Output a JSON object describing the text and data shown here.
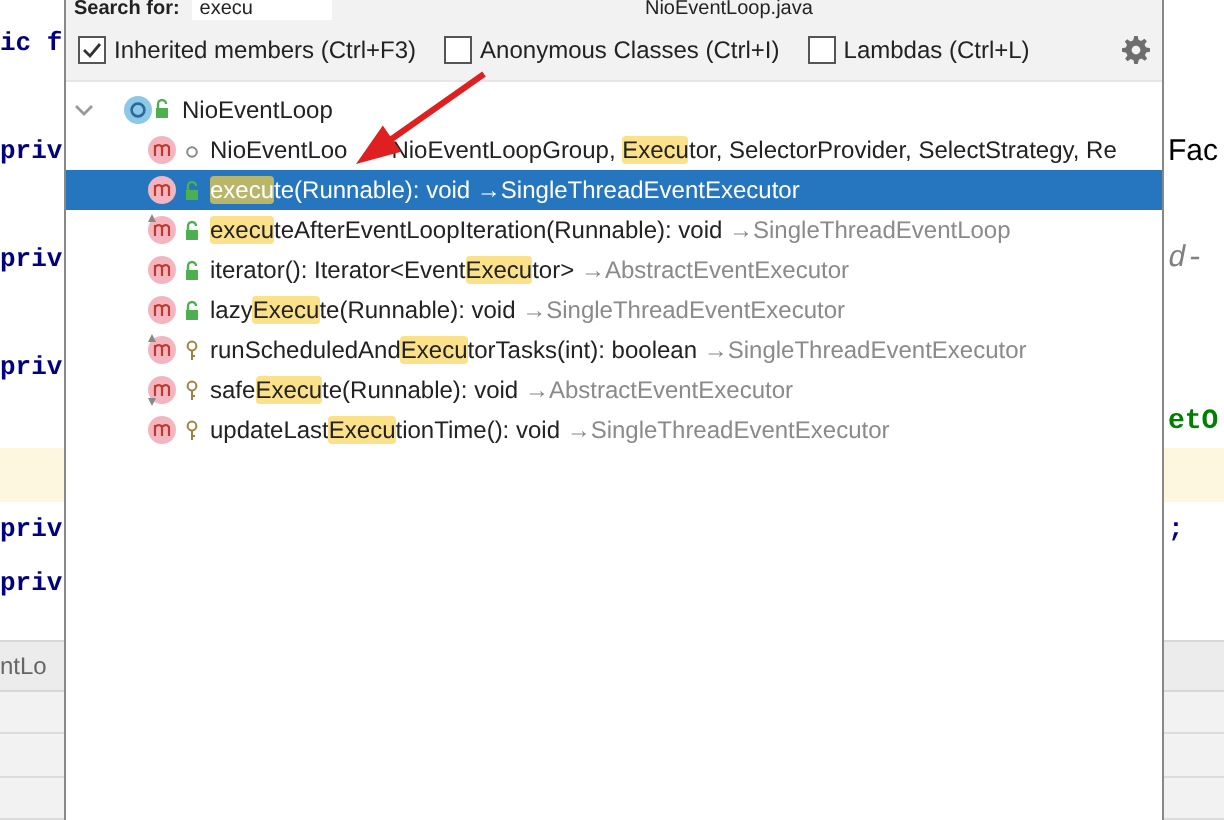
{
  "popup": {
    "search_label": "Search for:",
    "search_value": "execu",
    "file_title": "NioEventLoop.java",
    "options": [
      {
        "label": "Inherited members (Ctrl+F3)",
        "checked": true
      },
      {
        "label": "Anonymous Classes (Ctrl+I)",
        "checked": false
      },
      {
        "label": "Lambdas (Ctrl+L)",
        "checked": false
      }
    ],
    "tree": {
      "name": "NioEventLoop",
      "expanded": true,
      "children": [
        {
          "parts": [
            {
              "text": "NioEventLoo"
            },
            {
              "text": "NioEventLoopGroup, ",
              "after_arrow": true
            },
            {
              "text": "Execu",
              "match": true
            },
            {
              "text": "tor, SelectorProvider, SelectStrategy, Re"
            }
          ],
          "kind": "package",
          "overrides": false,
          "implements": false,
          "selected": false
        },
        {
          "parts": [
            {
              "text": "execu",
              "match": true
            },
            {
              "text": "te(Runnable): void "
            }
          ],
          "origin": "→SingleThreadEventExecutor",
          "kind": "public",
          "overrides": false,
          "implements": false,
          "selected": true
        },
        {
          "parts": [
            {
              "text": "execu",
              "match": true
            },
            {
              "text": "teAfterEventLoopIteration(Runnable): void "
            }
          ],
          "origin": "→SingleThreadEventLoop",
          "kind": "public",
          "overrides": true,
          "implements": false,
          "selected": false
        },
        {
          "parts": [
            {
              "text": "iterator(): Iterator<Event"
            },
            {
              "text": "Execu",
              "match": true
            },
            {
              "text": "tor> "
            }
          ],
          "origin": "→AbstractEventExecutor",
          "kind": "public",
          "overrides": false,
          "implements": false,
          "selected": false
        },
        {
          "parts": [
            {
              "text": "lazy"
            },
            {
              "text": "Execu",
              "match": true
            },
            {
              "text": "te(Runnable): void "
            }
          ],
          "origin": "→SingleThreadEventExecutor",
          "kind": "public",
          "overrides": false,
          "implements": false,
          "selected": false
        },
        {
          "parts": [
            {
              "text": "runScheduledAnd"
            },
            {
              "text": "Execu",
              "match": true
            },
            {
              "text": "torTasks(int): boolean "
            }
          ],
          "origin": "→SingleThreadEventExecutor",
          "kind": "protected",
          "overrides": true,
          "implements": false,
          "selected": false
        },
        {
          "parts": [
            {
              "text": "safe"
            },
            {
              "text": "Execu",
              "match": true
            },
            {
              "text": "te(Runnable): void "
            }
          ],
          "origin": "→AbstractEventExecutor",
          "kind": "protected",
          "overrides": false,
          "implements": true,
          "selected": false
        },
        {
          "parts": [
            {
              "text": "updateLast"
            },
            {
              "text": "Execu",
              "match": true
            },
            {
              "text": "tionTime(): void "
            }
          ],
          "origin": "→SingleThreadEventExecutor",
          "kind": "protected",
          "overrides": false,
          "implements": false,
          "selected": false
        }
      ]
    }
  },
  "editor_left": [
    {
      "kind": "code",
      "text": "ic f"
    },
    {
      "kind": "blank"
    },
    {
      "kind": "code",
      "text": "priv"
    },
    {
      "kind": "blank"
    },
    {
      "kind": "code",
      "text": "priv"
    },
    {
      "kind": "blank"
    },
    {
      "kind": "code",
      "text": "priv"
    },
    {
      "kind": "blank"
    },
    {
      "kind": "caret"
    },
    {
      "kind": "code",
      "text": "priv"
    },
    {
      "kind": "code",
      "text": "priv"
    }
  ],
  "editor_right": [
    {
      "kind": "blank"
    },
    {
      "kind": "blank"
    },
    {
      "kind": "plain",
      "text": "Fac"
    },
    {
      "kind": "blank"
    },
    {
      "kind": "comment",
      "text": "d-"
    },
    {
      "kind": "blank"
    },
    {
      "kind": "blank"
    },
    {
      "kind": "call",
      "text": "etO"
    },
    {
      "kind": "caret"
    },
    {
      "kind": "code",
      "text": ";"
    },
    {
      "kind": "blank"
    }
  ],
  "editor_tab": "ntLo"
}
